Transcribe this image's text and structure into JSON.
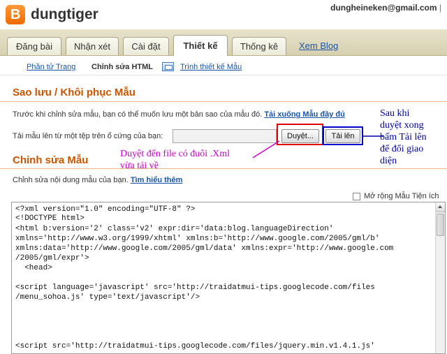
{
  "header": {
    "site_name": "dungtiger",
    "account_email": "dungheineken@gmail.com",
    "account_separator": "|"
  },
  "tabs": [
    {
      "label": "Đăng bài"
    },
    {
      "label": "Nhận xét"
    },
    {
      "label": "Cài đặt"
    },
    {
      "label": "Thiết kế",
      "active": true
    },
    {
      "label": "Thống kê"
    }
  ],
  "view_blog_link": "Xem Blog",
  "subnav": {
    "items": [
      {
        "label": "Phần tử Trang"
      },
      {
        "label": "Chỉnh sửa HTML",
        "current": true
      },
      {
        "label": "Trình thiết kế Mẫu"
      }
    ]
  },
  "backup": {
    "title": "Sao lưu / Khôi phục Mẫu",
    "description": "Trước khi chỉnh sửa mẫu, bạn có thể muốn lưu một bản sao của mẫu đó.",
    "download_link": "Tải xuống Mẫu đầy đủ",
    "upload_label": "Tải mẫu lên từ một tệp trên ổ cứng của bạn:",
    "browse_button": "Duyệt...",
    "upload_button": "Tải lên"
  },
  "annotations": {
    "browse_note_line1": "Duyệt đến file có đuôi .Xml",
    "browse_note_line2": "vừa tải về",
    "upload_note": [
      "Sau khi",
      "duyệt xong",
      "bấm Tải lên",
      "để đổi giao",
      "diện"
    ],
    "colors": {
      "browse": "#cc00cc",
      "upload": "#0000aa",
      "browse_box": "#e00000",
      "upload_box": "#0000cc"
    }
  },
  "edit": {
    "title": "Chỉnh sửa Mẫu",
    "description": "Chỉnh sửa nội dung mẫu của bạn.",
    "learn_more": "Tìm hiểu thêm",
    "expand_widgets_label": "Mở rộng Mẫu Tiện ích"
  },
  "code_lines": [
    "<?xml version=\"1.0\" encoding=\"UTF-8\" ?>",
    "<!DOCTYPE html>",
    "<html b:version='2' class='v2' expr:dir='data:blog.languageDirection'",
    "xmlns='http://www.w3.org/1999/xhtml' xmlns:b='http://www.google.com/2005/gml/b'",
    "xmlns:data='http://www.google.com/2005/gml/data' xmlns:expr='http://www.google.com",
    "/2005/gml/expr'>",
    "  <head>",
    "",
    "<script language='javascript' src='http://traidatmui-tips.googlecode.com/files",
    "/menu_sohoa.js' type='text/javascript'/>",
    "",
    "",
    "",
    "",
    "",
    "<script src='http://traidatmui-tips.googlecode.com/files/jquery.min.v1.4.1.js'"
  ]
}
